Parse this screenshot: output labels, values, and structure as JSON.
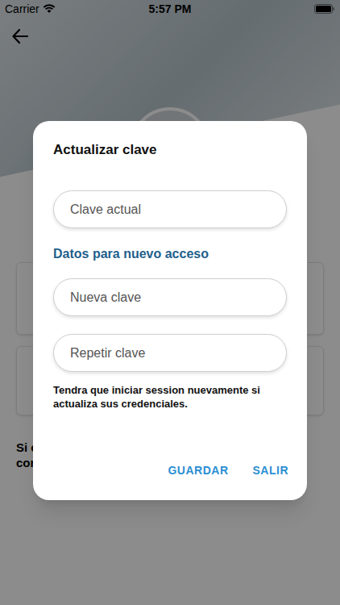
{
  "status_bar": {
    "carrier": "Carrier",
    "time": "5:57 PM"
  },
  "background": {
    "texts": [
      "Si c",
      "con"
    ]
  },
  "dialog": {
    "title": "Actualizar clave",
    "current_field": {
      "placeholder": "Clave actual"
    },
    "section_title": "Datos para nuevo acceso",
    "new_field": {
      "placeholder": "Nueva clave"
    },
    "repeat_field": {
      "placeholder": "Repetir clave"
    },
    "note": "Tendra que iniciar session nuevamente si actualiza sus credenciales.",
    "buttons": [
      "GUARDAR",
      "SALIR"
    ]
  }
}
